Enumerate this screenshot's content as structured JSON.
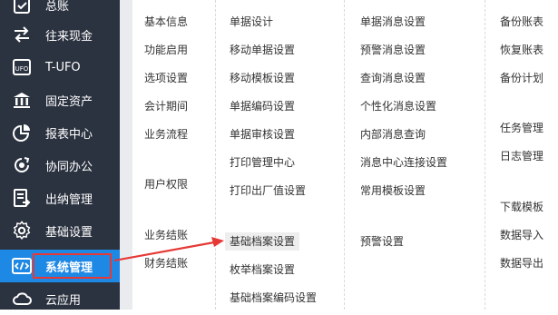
{
  "sidebar": {
    "items": [
      {
        "label": "总账",
        "icon": "ledger-icon"
      },
      {
        "label": "往来现金",
        "icon": "exchange-icon"
      },
      {
        "label": "T-UFO",
        "icon": "ufo-icon"
      },
      {
        "label": "固定资产",
        "icon": "bank-icon"
      },
      {
        "label": "报表中心",
        "icon": "pie-chart-icon"
      },
      {
        "label": "协同办公",
        "icon": "collaboration-icon"
      },
      {
        "label": "出纳管理",
        "icon": "cashier-icon"
      },
      {
        "label": "基础设置",
        "icon": "settings-icon"
      },
      {
        "label": "系统管理",
        "icon": "code-icon"
      },
      {
        "label": "云应用",
        "icon": "cloud-icon"
      }
    ],
    "active_index": 8
  },
  "menu": {
    "col1": [
      "基本信息",
      "功能启用",
      "选项设置",
      "会计期间",
      "业务流程",
      "用户权限",
      "业务结账",
      "财务结账"
    ],
    "col2": [
      "单据设计",
      "移动单据设置",
      "移动模板设置",
      "单据编码设置",
      "单据审核设置",
      "打印管理中心",
      "打印出厂值设置",
      "基础档案设置",
      "枚举档案设置",
      "基础档案编码设置"
    ],
    "col3": [
      "单据消息设置",
      "预警消息设置",
      "查询消息设置",
      "个性化消息设置",
      "内部消息查询",
      "消息中心连接设置",
      "常用模板设置",
      "预警设置"
    ],
    "col4": [
      "备份账表",
      "恢复账表",
      "备份计划",
      "任务管理",
      "日志管理",
      "下载模板",
      "数据导入",
      "数据导出"
    ]
  },
  "colors": {
    "sidebar_bg": "#2c3340",
    "active_bg": "#1e88e5",
    "annotation_red": "#e53935"
  }
}
